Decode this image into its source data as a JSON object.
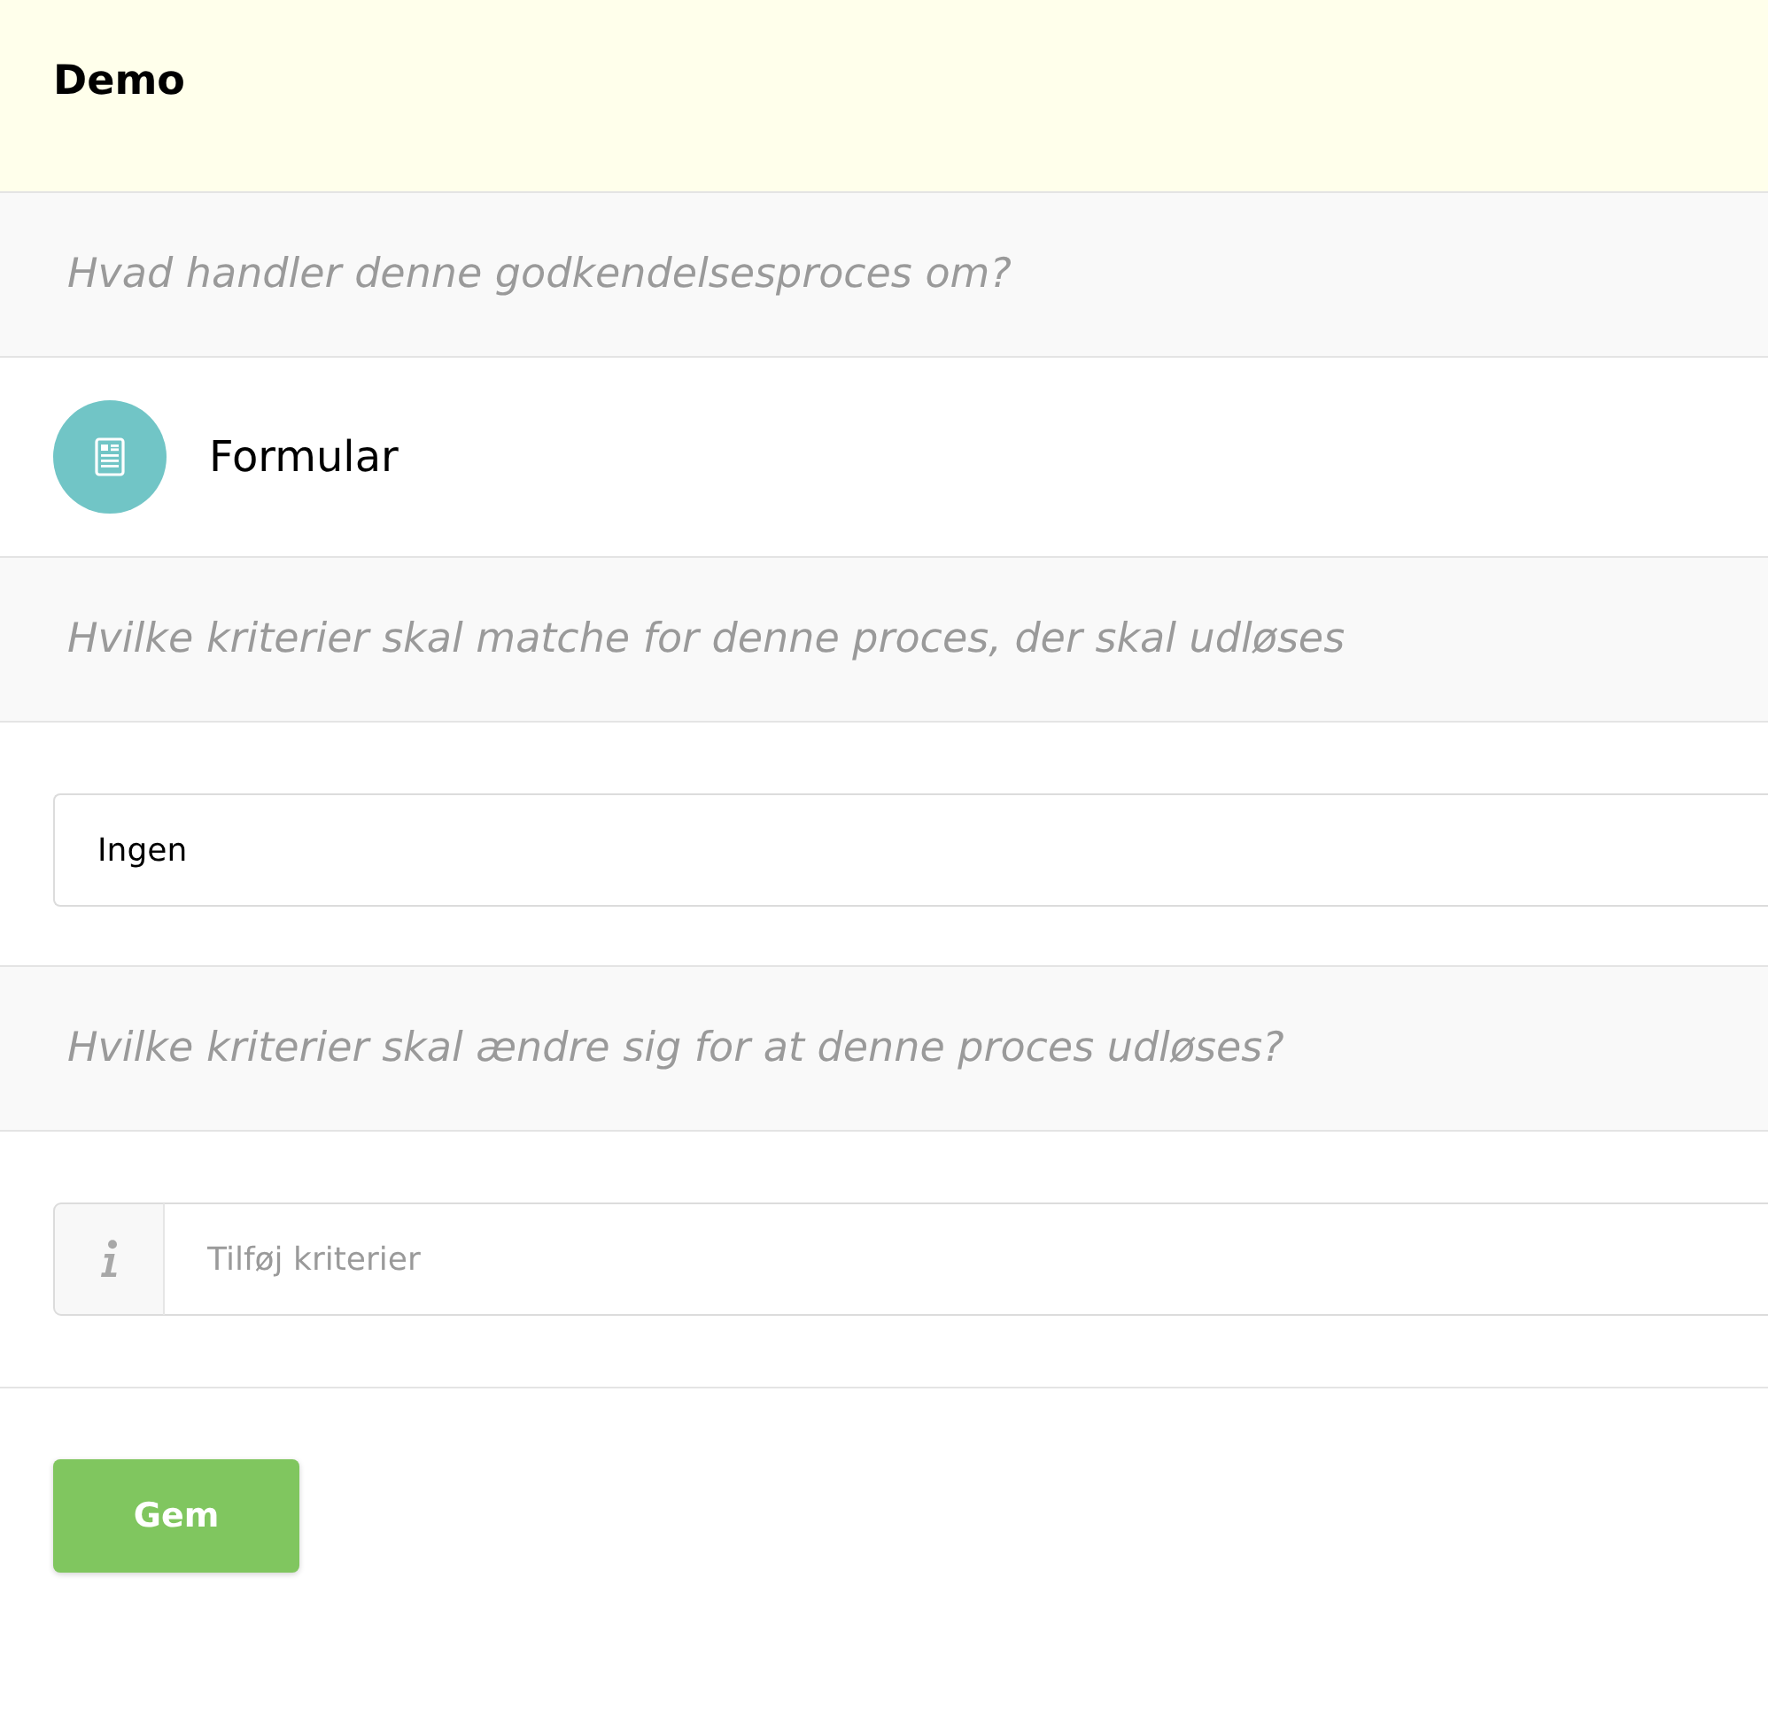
{
  "header": {
    "title": "Demo"
  },
  "sections": [
    {
      "kind": "prompt",
      "text": "Hvad handler denne godkendelsesproces om?"
    },
    {
      "kind": "type",
      "label": "Formular"
    },
    {
      "kind": "prompt",
      "text": "Hvilke kriterier skal matche for denne proces, der skal udløses"
    },
    {
      "kind": "field",
      "value": "Ingen"
    },
    {
      "kind": "prompt",
      "text": "Hvilke kriterier skal ændre sig for at denne proces udløses?"
    },
    {
      "kind": "info_field",
      "placeholder": "Tilføj kriterier"
    }
  ],
  "save_button": {
    "label": "Gem"
  }
}
